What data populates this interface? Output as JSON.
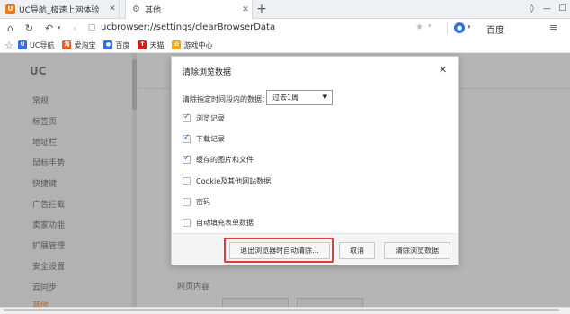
{
  "tabs": [
    {
      "label": "UC导航_极速上网体验",
      "icon": "uc-icon",
      "active": false
    },
    {
      "label": "其他",
      "icon": "gear-icon",
      "active": true
    }
  ],
  "toolbar": {
    "url": "ucbrowser://settings/clearBrowserData",
    "search_engine": "百度"
  },
  "bookmarks": [
    {
      "label": "UC导航",
      "icon": "uc-bookmark-icon",
      "color": "#2d6ff0"
    },
    {
      "label": "爱淘宝",
      "icon": "taobao-icon",
      "color": "#f05a22"
    },
    {
      "label": "百度",
      "icon": "baidu-icon",
      "color": "#2d6ff0"
    },
    {
      "label": "天猫",
      "icon": "tmall-icon",
      "color": "#d81b1b"
    },
    {
      "label": "游戏中心",
      "icon": "game-icon",
      "color": "#f4a51c"
    }
  ],
  "sidebar": {
    "logo": "UC",
    "items": [
      "常规",
      "标签页",
      "地址栏",
      "鼠标手势",
      "快捷键",
      "广告拦截",
      "卖家功能",
      "扩展管理",
      "安全设置",
      "云同步",
      "其他"
    ]
  },
  "content": {
    "section_title": "网页内容"
  },
  "dialog": {
    "title": "清除浏览数据",
    "range_label": "清除指定时间段内的数据：",
    "range_value": "过去1周",
    "options": [
      {
        "label": "浏览记录",
        "checked": true
      },
      {
        "label": "下载记录",
        "checked": true
      },
      {
        "label": "缓存的图片和文件",
        "checked": true
      },
      {
        "label": "Cookie及其他网站数据",
        "checked": false
      },
      {
        "label": "密码",
        "checked": false
      },
      {
        "label": "自动填充表单数据",
        "checked": false
      }
    ],
    "auto_clear_button": "退出浏览器时自动清除...",
    "cancel_button": "取消",
    "clear_button": "清除浏览数据"
  },
  "colors": {
    "accent": "#2b6fd8",
    "highlight": "#e53935"
  }
}
